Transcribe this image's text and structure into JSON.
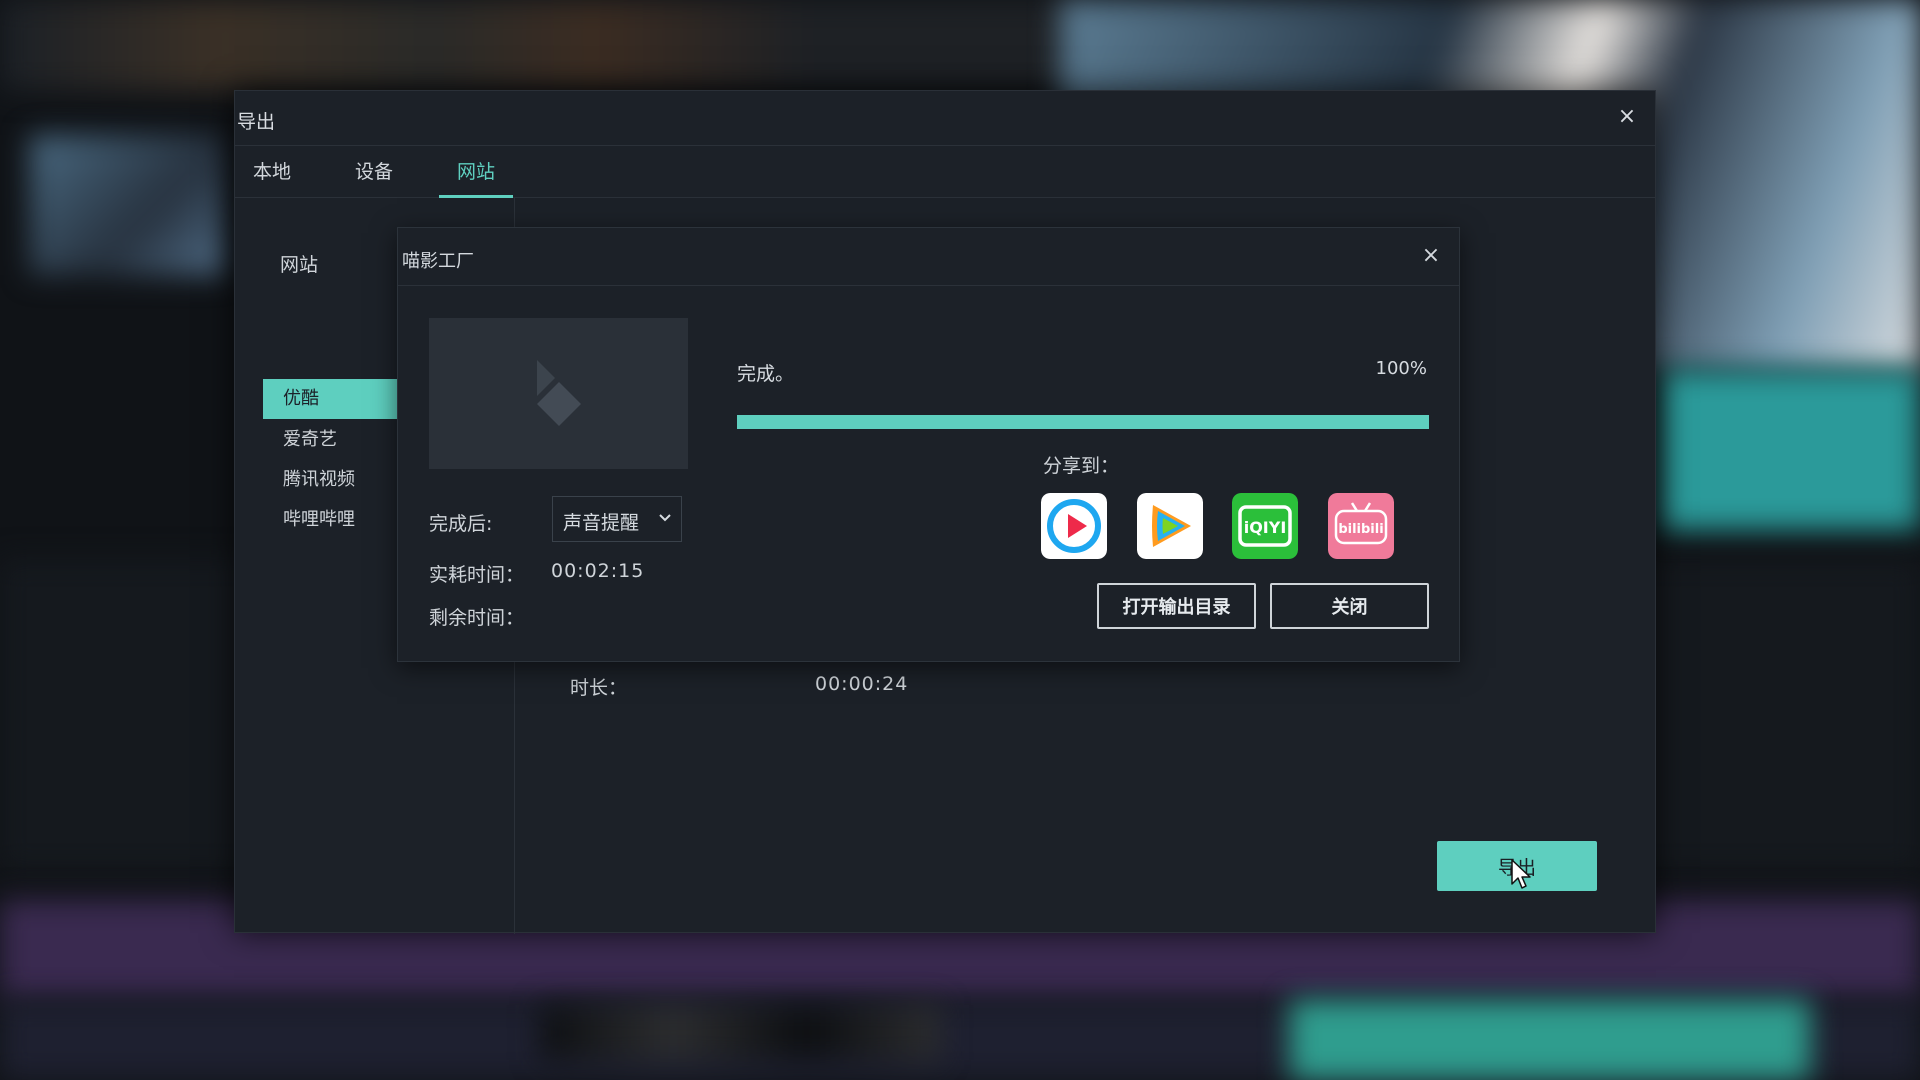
{
  "window": {
    "title": "导出",
    "close_icon": "×"
  },
  "tabs": [
    {
      "label": "本地",
      "active": false
    },
    {
      "label": "设备",
      "active": false
    },
    {
      "label": "网站",
      "active": true
    }
  ],
  "sidebar": {
    "heading": "网站",
    "items": [
      {
        "label": "优酷",
        "active": true
      },
      {
        "label": "爱奇艺",
        "active": false
      },
      {
        "label": "腾讯视频",
        "active": false
      },
      {
        "label": "哔哩哔哩",
        "active": false
      }
    ]
  },
  "main": {
    "duration_label": "时长：",
    "duration_value": "00:00:24",
    "export_button": "导出"
  },
  "dialog": {
    "title": "喵影工厂",
    "close_icon": "×",
    "status": "完成。",
    "progress_percent_text": "100%",
    "progress": 1.0,
    "after_label": "完成后:",
    "after_value": "声音提醒",
    "elapsed_label": "实耗时间：",
    "elapsed_value": "00:02:15",
    "remaining_label": "剩余时间：",
    "remaining_value": "",
    "share_label": "分享到：",
    "share_icons": [
      "youku-icon",
      "tencent-video-icon",
      "iqiyi-icon",
      "bilibili-icon"
    ],
    "iqiyi_icon_text": "iQIYI",
    "bilibili_icon_text": "bilibili",
    "open_folder_button": "打开输出目录",
    "close_button": "关闭"
  },
  "colors": {
    "accent": "#5ecfbf",
    "panel": "#1c2128",
    "iqiyi_green": "#2bbf3a",
    "bilibili_pink": "#f07a9a"
  }
}
